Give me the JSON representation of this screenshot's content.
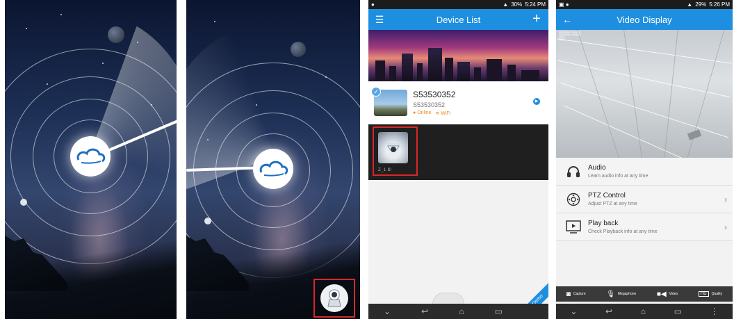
{
  "screen3": {
    "status": {
      "percent": "30%",
      "time": "5:24 PM"
    },
    "title": "Device List",
    "device": {
      "name": "S53530352",
      "id": "S53530352",
      "online": "Online",
      "wifi": "WiFi"
    },
    "camera_label": "Z_1   $!",
    "demo": "Demo"
  },
  "screen4": {
    "status": {
      "percent": "29%",
      "time": "5:26 PM"
    },
    "title": "Video Display",
    "menu": [
      {
        "title": "Audio",
        "subtitle": "Learn audio info at any time"
      },
      {
        "title": "PTZ Control",
        "subtitle": "Adjust PTZ at any time"
      },
      {
        "title": "Play back",
        "subtitle": "Check Playback info at any time"
      }
    ],
    "toolbar": [
      "Capture",
      "Megaphone",
      "Video",
      "Quality"
    ],
    "toolbar_hd": "HD"
  },
  "colors": {
    "accent": "#1e8fe0",
    "highlight": "#d8282a",
    "online": "#f08a1e"
  }
}
